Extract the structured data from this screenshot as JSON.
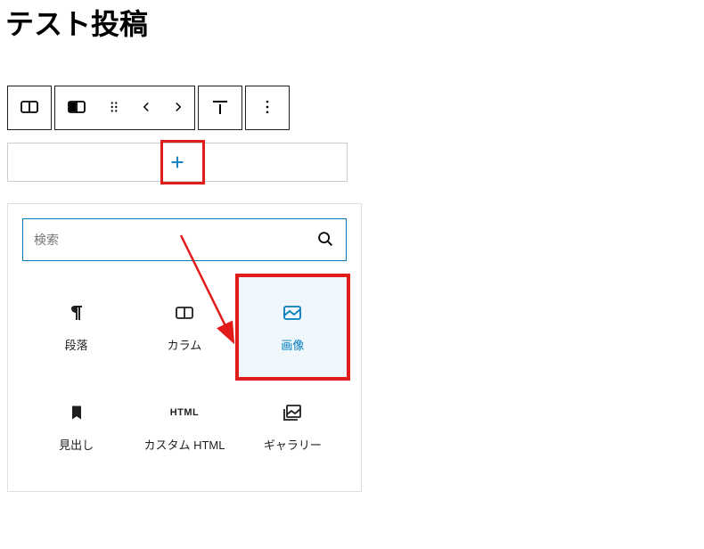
{
  "title": "テスト投稿",
  "toolbar": {
    "columns_btn": "columns-block",
    "half_btn": "half-block",
    "drag_btn": "drag-handle",
    "movers": "move",
    "align_btn": "align",
    "more_btn": "more-options"
  },
  "appender": {
    "tooltip": "ブロックを追加"
  },
  "search": {
    "placeholder": "検索"
  },
  "blocks": [
    {
      "id": "paragraph",
      "label": "段落"
    },
    {
      "id": "columns",
      "label": "カラム"
    },
    {
      "id": "image",
      "label": "画像",
      "highlighted": true
    },
    {
      "id": "heading",
      "label": "見出し"
    },
    {
      "id": "html",
      "label": "カスタム HTML"
    },
    {
      "id": "gallery",
      "label": "ギャラリー"
    }
  ],
  "colors": {
    "accent": "#007cba",
    "highlight_red": "#e21b1b"
  }
}
